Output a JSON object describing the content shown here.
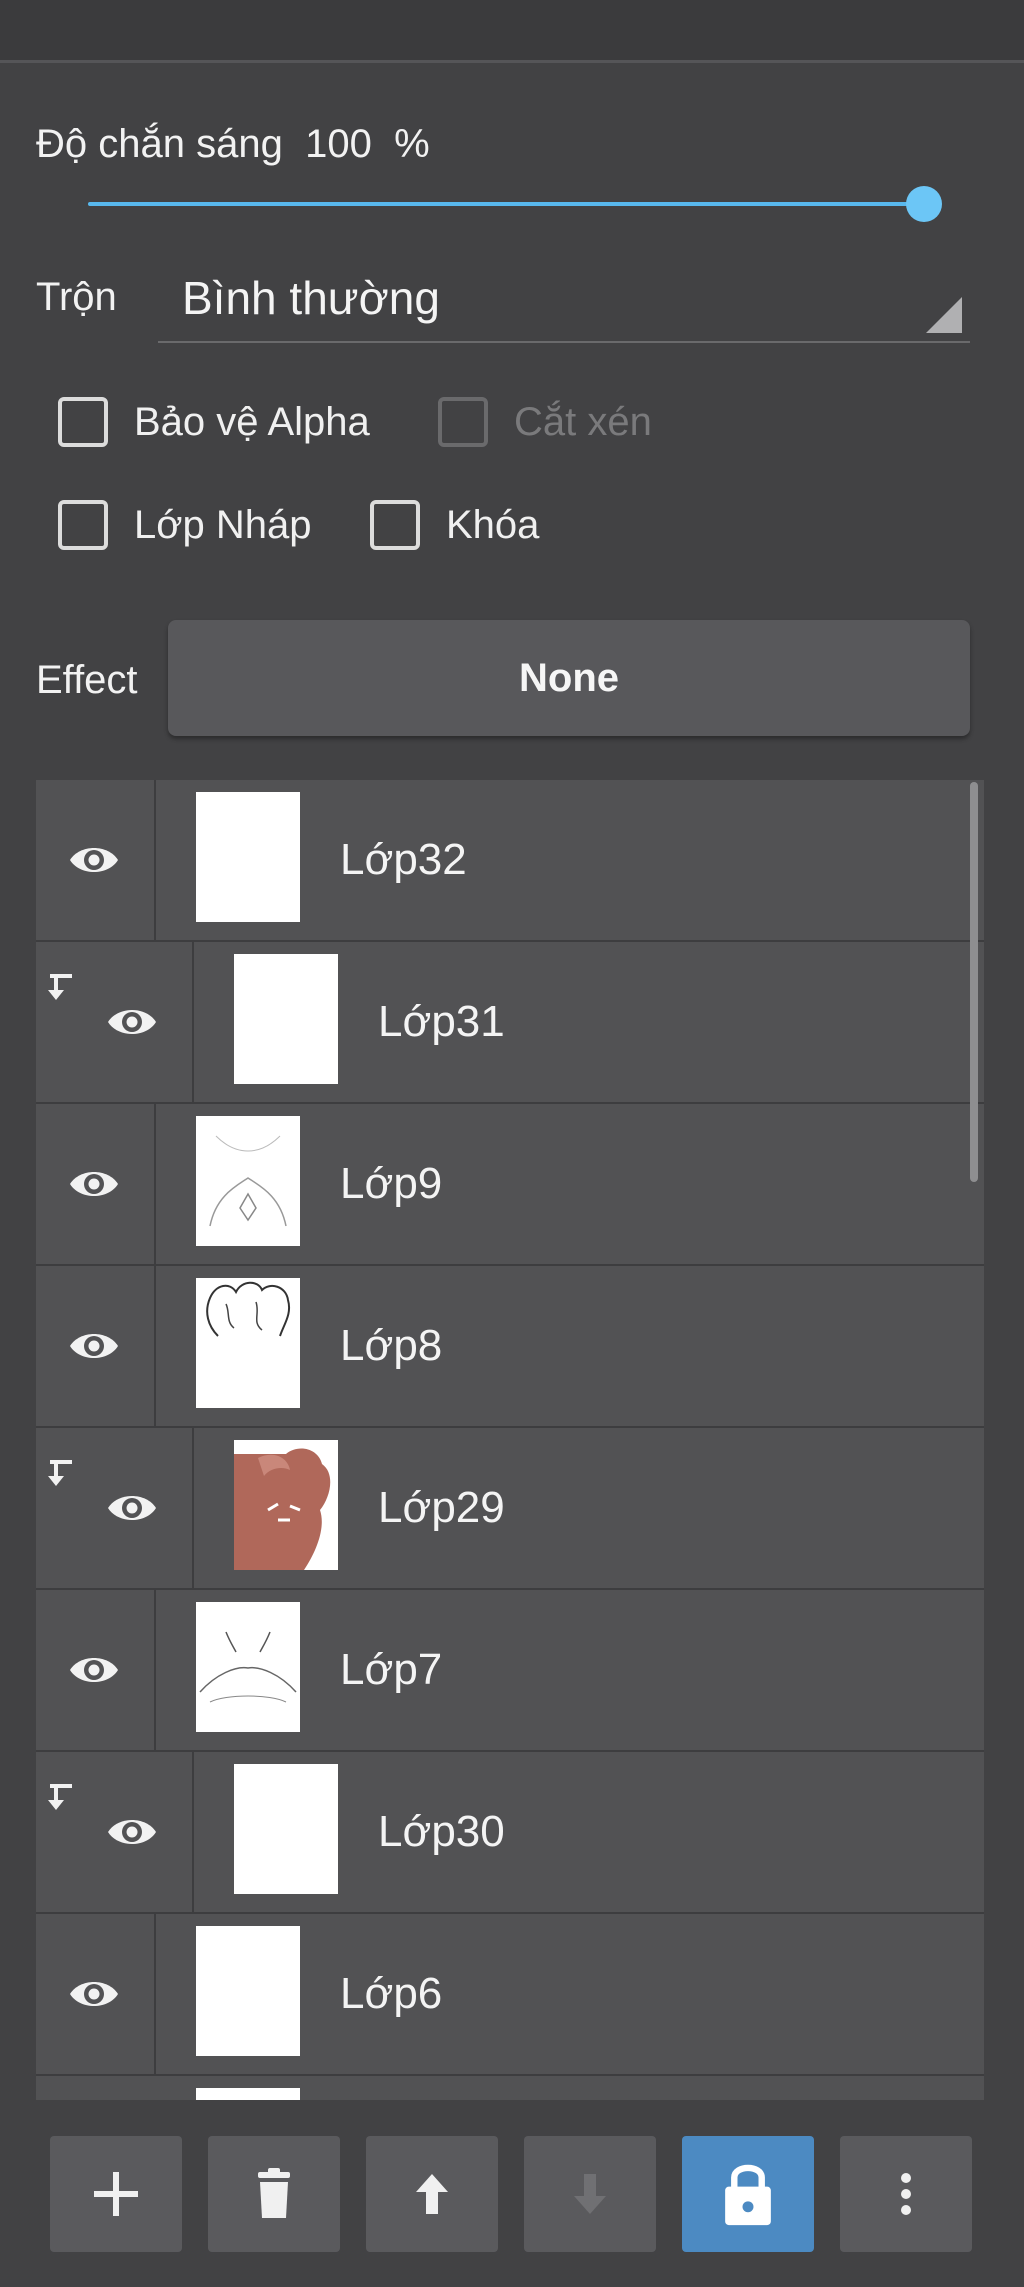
{
  "opacity": {
    "label": "Độ chắn sáng",
    "value": "100",
    "unit": "%",
    "fraction": 1.0
  },
  "blend": {
    "label": "Trộn",
    "value": "Bình thường"
  },
  "checkboxes": {
    "alpha_protect": {
      "label": "Bảo vệ Alpha",
      "checked": false,
      "enabled": true
    },
    "clipping": {
      "label": "Cắt xén",
      "checked": false,
      "enabled": false
    },
    "draft": {
      "label": "Lớp Nháp",
      "checked": false,
      "enabled": true
    },
    "lock": {
      "label": "Khóa",
      "checked": false,
      "enabled": true
    }
  },
  "effect": {
    "label": "Effect",
    "value": "None"
  },
  "layers": [
    {
      "name": "Lớp32",
      "clipped": false,
      "thumb": "white"
    },
    {
      "name": "Lớp31",
      "clipped": true,
      "thumb": "white"
    },
    {
      "name": "Lớp9",
      "clipped": false,
      "thumb": "sketch-body"
    },
    {
      "name": "Lớp8",
      "clipped": false,
      "thumb": "sketch-hair"
    },
    {
      "name": "Lớp29",
      "clipped": true,
      "thumb": "brown-fill"
    },
    {
      "name": "Lớp7",
      "clipped": false,
      "thumb": "sketch-neck"
    },
    {
      "name": "Lớp30",
      "clipped": true,
      "thumb": "white"
    },
    {
      "name": "Lớp6",
      "clipped": false,
      "thumb": "white"
    }
  ],
  "toolbar": [
    {
      "icon": "plus-icon",
      "active": false,
      "enabled": true
    },
    {
      "icon": "trash-icon",
      "active": false,
      "enabled": true
    },
    {
      "icon": "arrow-up-icon",
      "active": false,
      "enabled": true
    },
    {
      "icon": "arrow-down-icon",
      "active": false,
      "enabled": false
    },
    {
      "icon": "lock-icon",
      "active": true,
      "enabled": true
    },
    {
      "icon": "more-vertical-icon",
      "active": false,
      "enabled": true
    }
  ],
  "colors": {
    "accent": "#58b8ee",
    "active_button": "#4c8ac2",
    "background": "#424244",
    "row": "#525254"
  }
}
